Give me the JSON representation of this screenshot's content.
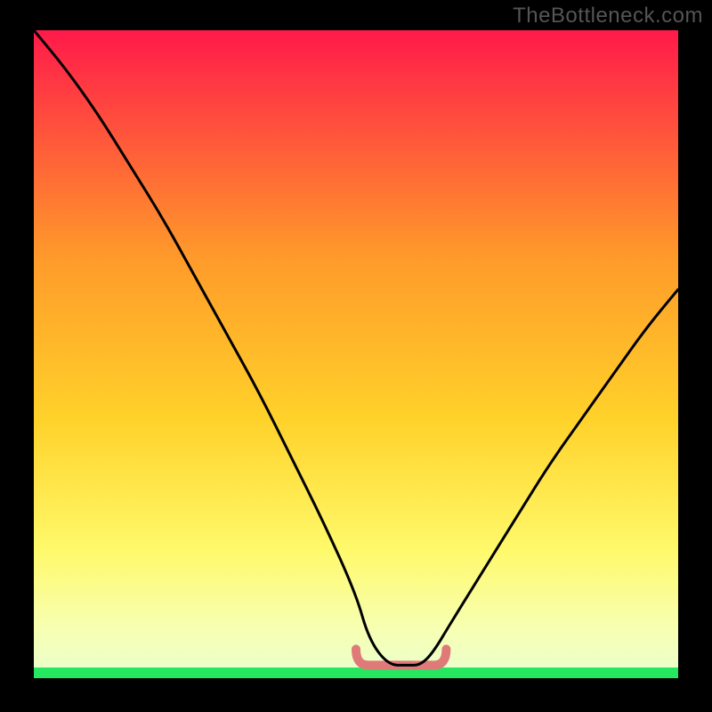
{
  "watermark": "TheBottleneck.com",
  "colors": {
    "black": "#000000",
    "grad_top": "#ff1a4a",
    "grad_mid1": "#ff6a2a",
    "grad_mid2": "#ffd22a",
    "grad_low": "#fff96a",
    "grad_pale": "#f7ffb0",
    "green": "#25e860",
    "curve": "#000000",
    "trough": "#e07a78"
  },
  "chart_data": {
    "type": "line",
    "title": "",
    "xlabel": "",
    "ylabel": "",
    "xlim": [
      0,
      100
    ],
    "ylim": [
      0,
      100
    ],
    "x": [
      0,
      5,
      10,
      15,
      20,
      25,
      30,
      35,
      40,
      45,
      50,
      52,
      55,
      58,
      60,
      62,
      65,
      70,
      75,
      80,
      85,
      90,
      95,
      100
    ],
    "values": [
      100,
      94,
      87,
      79,
      71,
      62,
      53,
      44,
      34,
      24,
      13,
      6,
      2,
      2,
      2,
      4,
      9,
      17,
      25,
      33,
      40,
      47,
      54,
      60
    ],
    "trough_range_x": [
      50,
      64
    ],
    "trough_value": 2,
    "annotations": []
  }
}
